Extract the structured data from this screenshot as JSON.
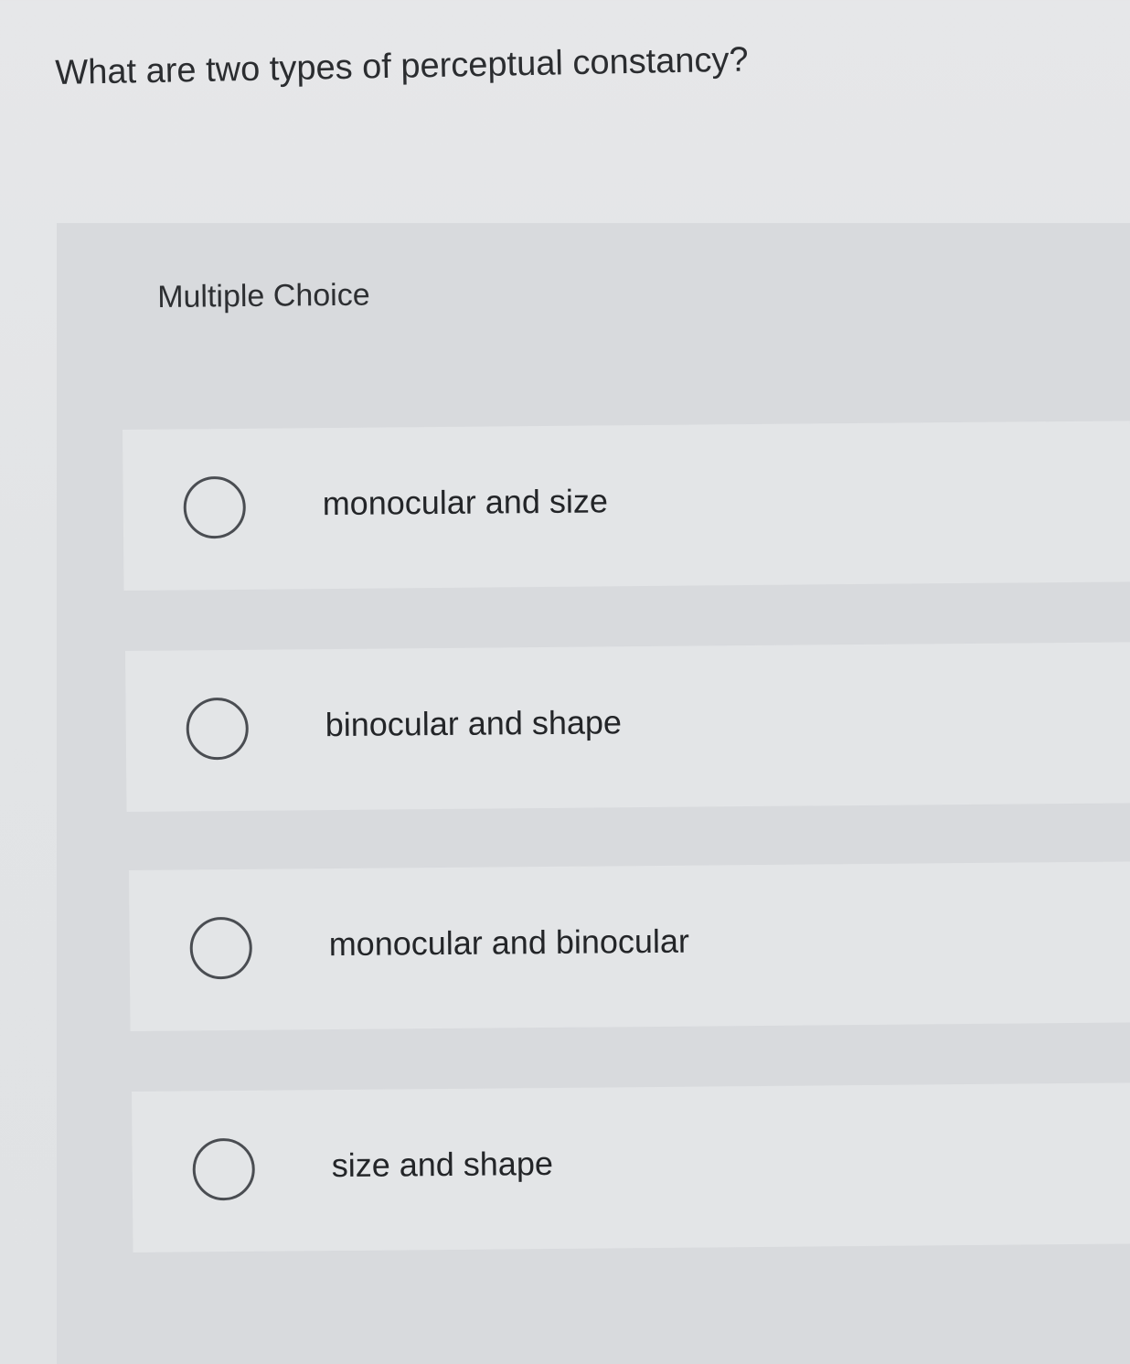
{
  "question": {
    "text": "What are two types of perceptual constancy?"
  },
  "answer_panel": {
    "header": "Multiple Choice",
    "options": [
      {
        "label": "monocular and size",
        "selected": false
      },
      {
        "label": "binocular and shape",
        "selected": false
      },
      {
        "label": "monocular and binocular",
        "selected": false
      },
      {
        "label": "size and shape",
        "selected": false
      }
    ]
  }
}
